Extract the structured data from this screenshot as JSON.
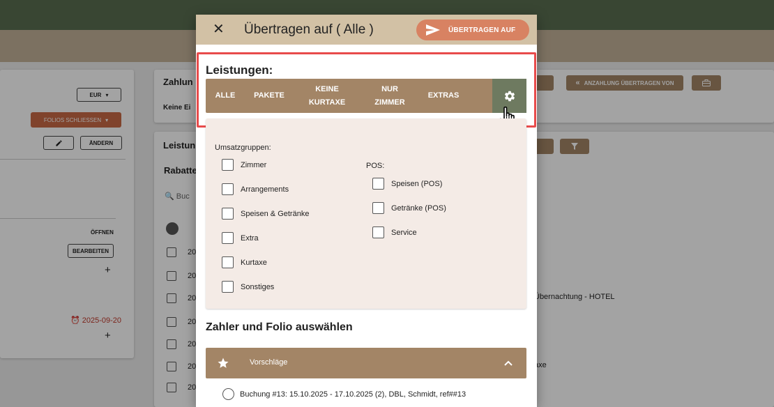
{
  "background": {
    "currency": "EUR",
    "close_folios": "FOLIOS SCHLIESSEN",
    "change": "ÄNDERN",
    "open": "ÖFFNEN",
    "edit": "BEARBEITEN",
    "plus": "+",
    "date": "2025-09-20",
    "payment_card_title": "Zahlun",
    "payment_card_text": "Keine Ei",
    "deposit_transfer": "ANZAHLUNG ÜBERTRAGEN VON",
    "services_card_title": "Leistun",
    "discount_label": "Rabatte",
    "search_placeholder": "Buc",
    "row_prefix": "20",
    "row_text_1": "Übernachtung - HOTEL",
    "row_text_2": "axe"
  },
  "dialog": {
    "title": "Übertragen auf ( Alle )",
    "transfer_button": "ÜBERTRAGEN AUF",
    "services_heading": "Leistungen:",
    "tabs": [
      "ALLE",
      "PAKETE",
      "KEINE KURTAXE",
      "NUR ZIMMER",
      "EXTRAS"
    ],
    "revenue_groups_label": "Umsatzgruppen:",
    "revenue_groups": [
      "Zimmer",
      "Arrangements",
      "Speisen & Getränke",
      "Extra",
      "Kurtaxe",
      "Sonstiges"
    ],
    "pos_label": "POS:",
    "pos_items": [
      "Speisen (POS)",
      "Getränke (POS)",
      "Service"
    ],
    "payer_heading": "Zahler und Folio auswählen",
    "suggestions_label": "Vorschläge",
    "suggestion_1": "Buchung #13: 15.10.2025 - 17.10.2025 (2), DBL, Schmidt, ref##13"
  },
  "colors": {
    "header_green": "#5a6e50",
    "tab_brown": "#a38566",
    "gear_green": "#6e7a60",
    "transfer_orange": "#d88262",
    "highlight_red": "#e84b4b"
  }
}
